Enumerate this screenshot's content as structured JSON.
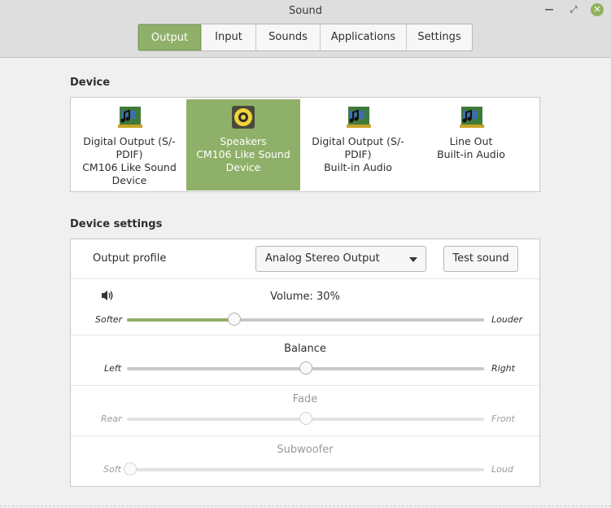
{
  "window": {
    "title": "Sound",
    "minimize_glyph": "—",
    "maximize_glyph": "⤢",
    "close_glyph": "✕"
  },
  "tabs": [
    {
      "label": "Output",
      "active": true
    },
    {
      "label": "Input",
      "active": false
    },
    {
      "label": "Sounds",
      "active": false
    },
    {
      "label": "Applications",
      "active": false
    },
    {
      "label": "Settings",
      "active": false
    }
  ],
  "device_section": {
    "title": "Device",
    "devices": [
      {
        "lines": [
          "Digital Output (S/-",
          "PDIF)",
          "CM106 Like Sound",
          "Device"
        ],
        "icon": "sound-card-icon",
        "selected": false
      },
      {
        "lines": [
          "Speakers",
          "CM106 Like Sound",
          "Device"
        ],
        "icon": "speaker-icon",
        "selected": true
      },
      {
        "lines": [
          "Digital Output (S/-",
          "PDIF)",
          "Built-in Audio"
        ],
        "icon": "sound-card-icon",
        "selected": false
      },
      {
        "lines": [
          "Line Out",
          "Built-in Audio"
        ],
        "icon": "sound-card-icon",
        "selected": false
      }
    ]
  },
  "settings_section": {
    "title": "Device settings",
    "output_profile_label": "Output profile",
    "output_profile_value": "Analog Stereo Output",
    "test_sound_label": "Test sound",
    "volume": {
      "title": "Volume: 30%",
      "left": "Softer",
      "right": "Louder",
      "value": 0.3,
      "icon": "volume-icon"
    },
    "balance": {
      "title": "Balance",
      "left": "Left",
      "right": "Right",
      "value": 0.5
    },
    "fade": {
      "title": "Fade",
      "left": "Rear",
      "right": "Front",
      "value": 0.5,
      "enabled": false
    },
    "subwoofer": {
      "title": "Subwoofer",
      "left": "Soft",
      "right": "Loud",
      "value": 0.0,
      "enabled": false
    }
  },
  "colors": {
    "accent": "#8fb068",
    "close_button": "#8fb35f"
  }
}
